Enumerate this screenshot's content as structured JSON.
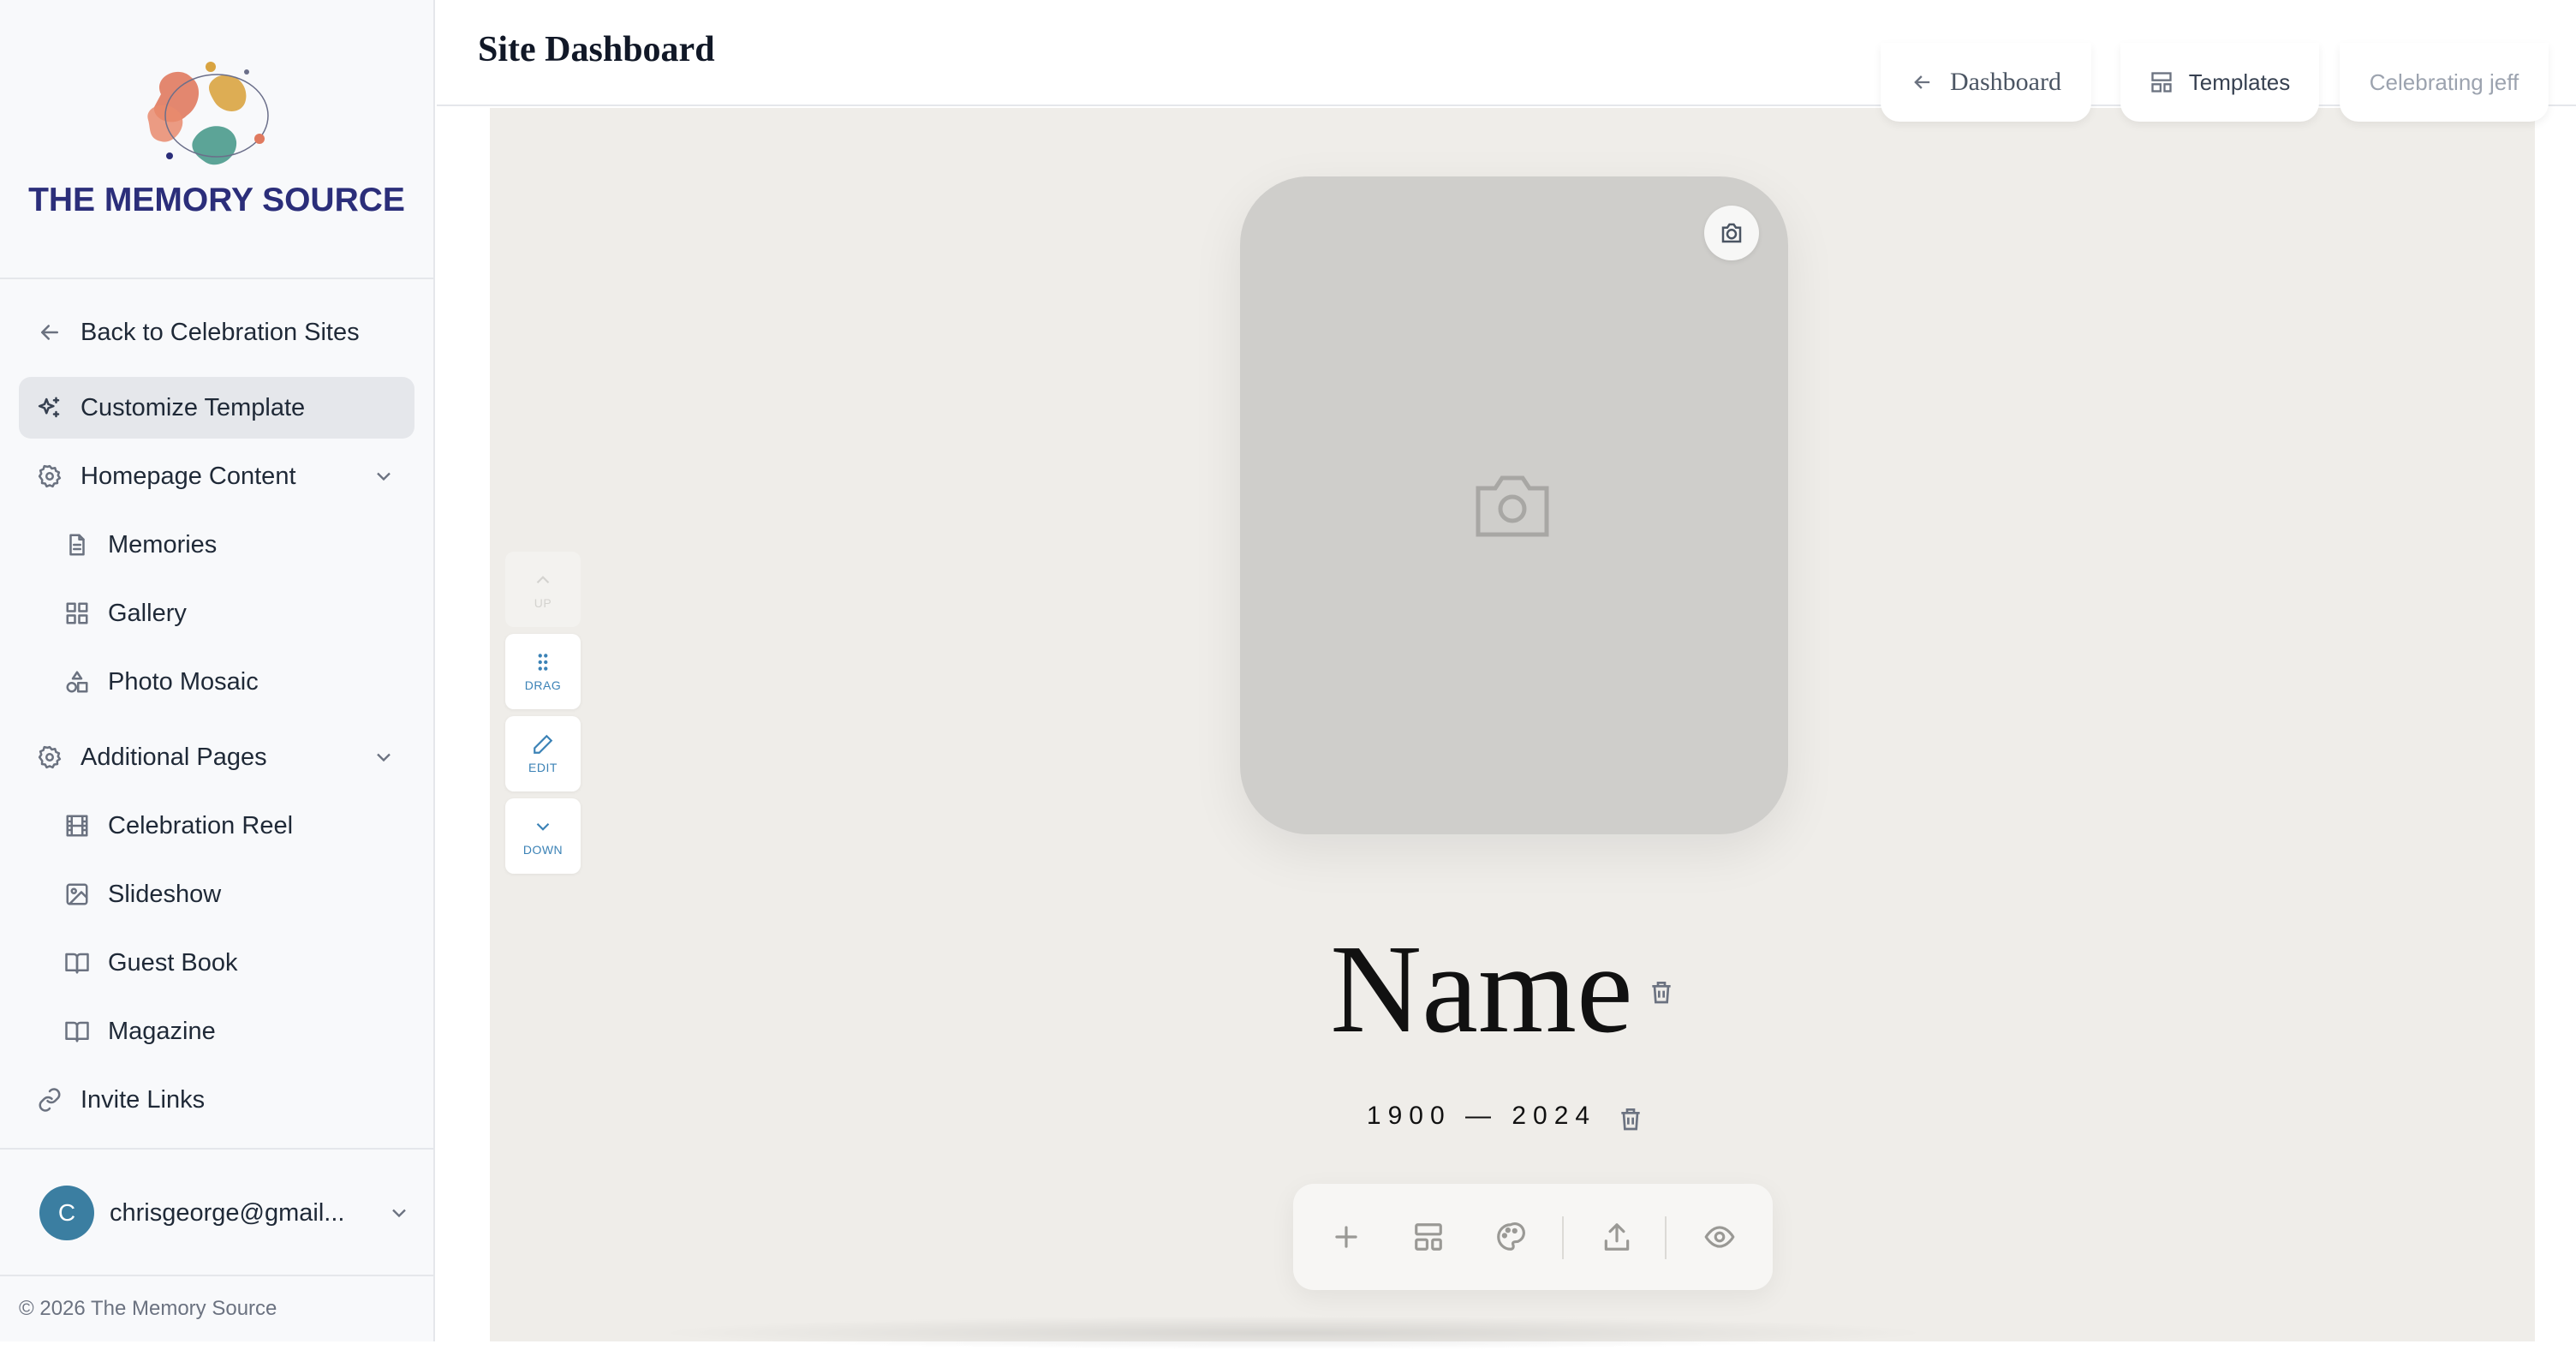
{
  "brand": {
    "name": "THE MEMORY SOURCE"
  },
  "sidebar": {
    "back_label": "Back to Celebration Sites",
    "items": [
      {
        "label": "Customize Template",
        "icon": "sparkles-icon",
        "active": true
      },
      {
        "label": "Homepage Content",
        "icon": "gear-icon",
        "expandable": true
      },
      {
        "label": "Memories",
        "icon": "document-icon",
        "sub": true
      },
      {
        "label": "Gallery",
        "icon": "grid-icon",
        "sub": true
      },
      {
        "label": "Photo Mosaic",
        "icon": "shapes-icon",
        "sub": true
      },
      {
        "label": "Additional Pages",
        "icon": "gear-icon",
        "expandable": true
      },
      {
        "label": "Celebration Reel",
        "icon": "film-icon",
        "sub": true
      },
      {
        "label": "Slideshow",
        "icon": "image-icon",
        "sub": true
      },
      {
        "label": "Guest Book",
        "icon": "book-icon",
        "sub": true
      },
      {
        "label": "Magazine",
        "icon": "book-icon",
        "sub": true
      },
      {
        "label": "Invite Links",
        "icon": "link-icon"
      }
    ],
    "user": {
      "initial": "C",
      "email": "chrisgeorge@gmail..."
    },
    "copyright": "© 2026 The Memory Source"
  },
  "header": {
    "title": "Site Dashboard",
    "dashboard_label": "Dashboard",
    "templates_label": "Templates",
    "site_label": "Celebrating jeff"
  },
  "section_controls": {
    "up_label": "UP",
    "drag_label": "DRAG",
    "edit_label": "EDIT",
    "down_label": "DOWN"
  },
  "hero": {
    "name": "Name",
    "dates": "1900 — 2024"
  },
  "toolbar": {
    "buttons": [
      "plus-icon",
      "layout-icon",
      "palette-icon",
      "upload-icon",
      "eye-icon"
    ]
  },
  "colors": {
    "brand_navy": "#2b2e7a",
    "avatar": "#3b7ea1",
    "canvas_bg": "#efede9",
    "photo_placeholder": "#cfcecb",
    "accent_blue": "#3b82b6"
  }
}
